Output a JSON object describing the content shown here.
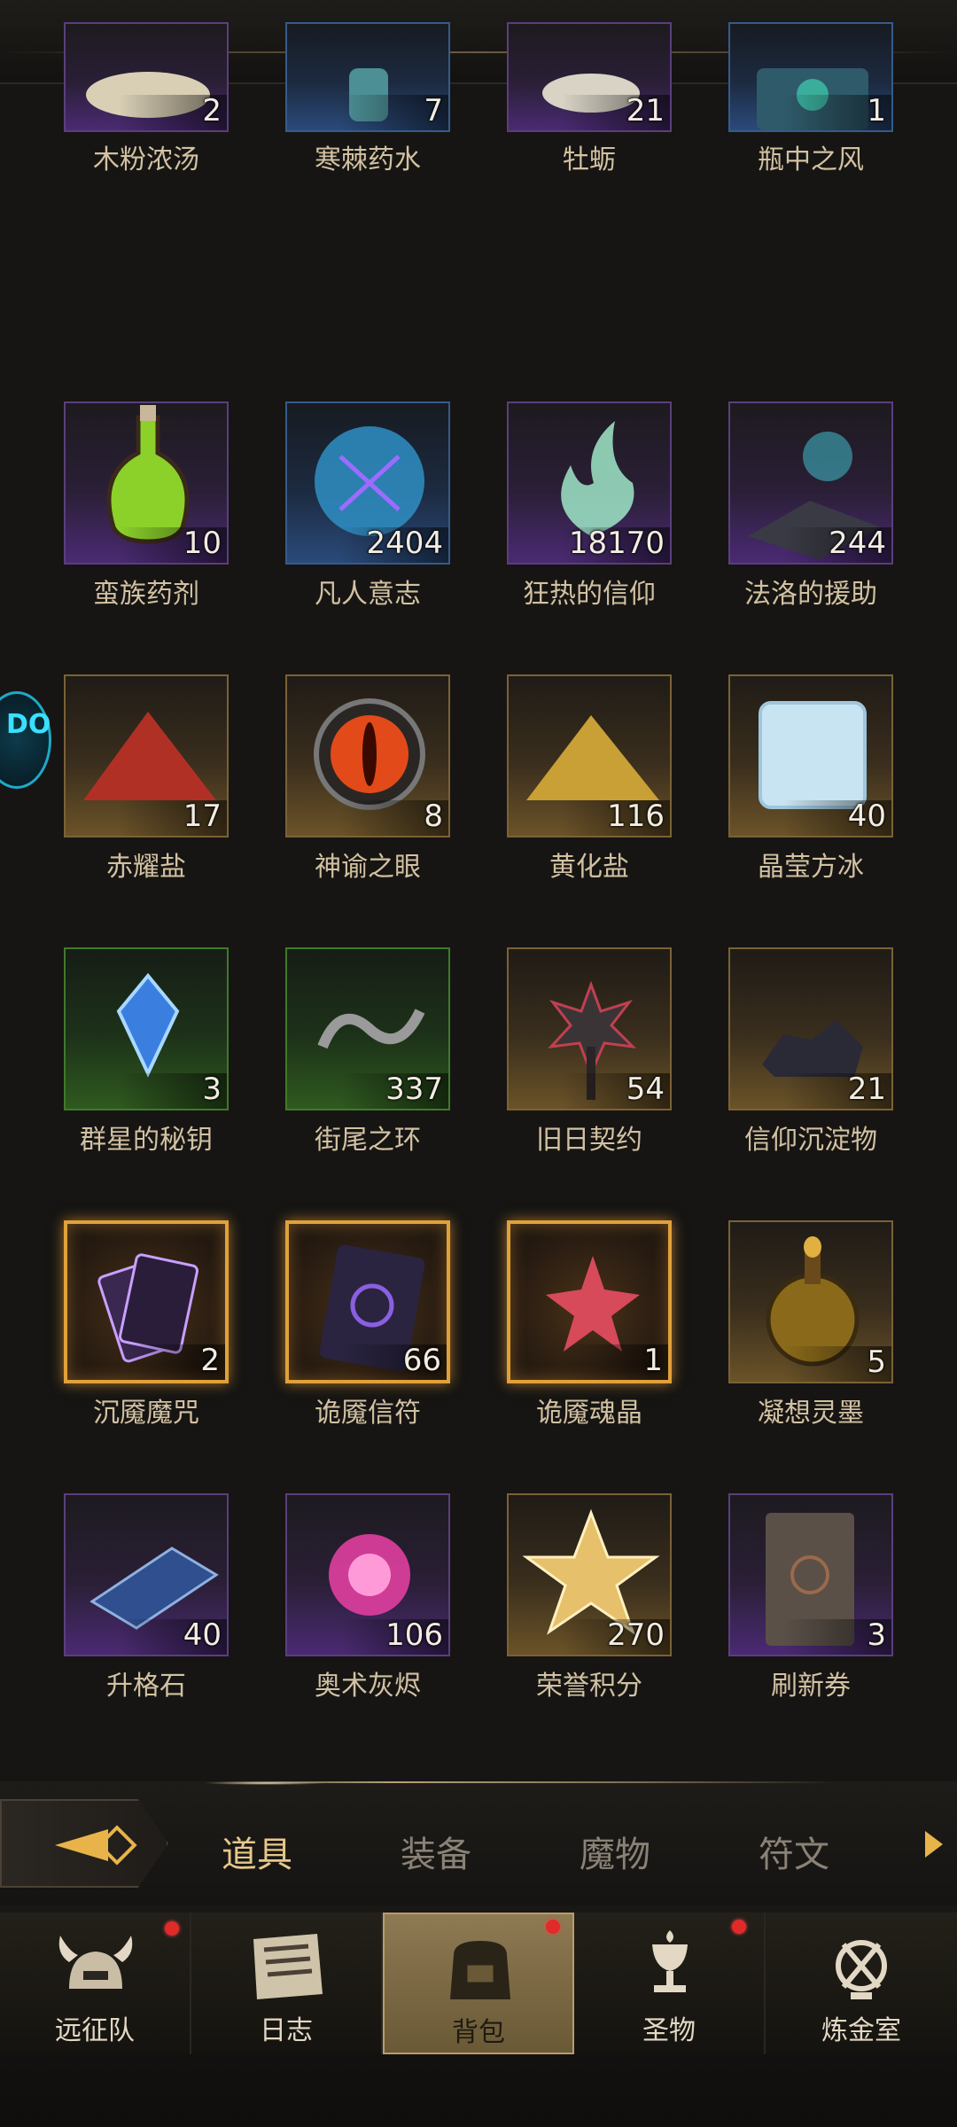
{
  "items": [
    {
      "name": "木粉浓汤",
      "qty": "2",
      "rarity": "purple",
      "icon": "soup-bowl-icon"
    },
    {
      "name": "寒棘药水",
      "qty": "7",
      "rarity": "blue",
      "icon": "potion-vial-icon"
    },
    {
      "name": "牡蛎",
      "qty": "21",
      "rarity": "purple",
      "icon": "oyster-icon"
    },
    {
      "name": "瓶中之风",
      "qty": "1",
      "rarity": "blue",
      "icon": "wind-bottle-icon"
    },
    {
      "name": "蛮族药剂",
      "qty": "10",
      "rarity": "purple",
      "icon": "green-potion-icon"
    },
    {
      "name": "凡人意志",
      "qty": "2404",
      "rarity": "blue",
      "icon": "crystal-orb-icon"
    },
    {
      "name": "狂热的信仰",
      "qty": "18170",
      "rarity": "purple",
      "icon": "spirit-flame-icon"
    },
    {
      "name": "法洛的援助",
      "qty": "244",
      "rarity": "purple",
      "icon": "spell-book-icon"
    },
    {
      "name": "赤耀盐",
      "qty": "17",
      "rarity": "gold",
      "icon": "red-salt-pile-icon"
    },
    {
      "name": "神谕之眼",
      "qty": "8",
      "rarity": "gold",
      "icon": "oracle-eye-icon"
    },
    {
      "name": "黄化盐",
      "qty": "116",
      "rarity": "gold",
      "icon": "yellow-salt-pile-icon"
    },
    {
      "name": "晶莹方冰",
      "qty": "40",
      "rarity": "gold",
      "icon": "ice-cube-icon"
    },
    {
      "name": "群星的秘钥",
      "qty": "3",
      "rarity": "green",
      "icon": "blue-gem-icon"
    },
    {
      "name": "街尾之环",
      "qty": "337",
      "rarity": "green",
      "icon": "infinity-ring-icon"
    },
    {
      "name": "旧日契约",
      "qty": "54",
      "rarity": "gold",
      "icon": "spiked-mace-icon"
    },
    {
      "name": "信仰沉淀物",
      "qty": "21",
      "rarity": "gold",
      "icon": "ore-chunks-icon"
    },
    {
      "name": "沉魇魔咒",
      "qty": "2",
      "rarity": "legend",
      "icon": "cursed-cards-icon"
    },
    {
      "name": "诡魇信符",
      "qty": "66",
      "rarity": "legend",
      "icon": "dark-tablet-icon"
    },
    {
      "name": "诡魇魂晶",
      "qty": "1",
      "rarity": "legend",
      "icon": "star-crystal-icon"
    },
    {
      "name": "凝想灵墨",
      "qty": "5",
      "rarity": "gold",
      "icon": "ink-flask-icon"
    },
    {
      "name": "升格石",
      "qty": "40",
      "rarity": "purple",
      "icon": "blue-ingot-icon"
    },
    {
      "name": "奥术灰烬",
      "qty": "106",
      "rarity": "purple",
      "icon": "arcane-ash-icon"
    },
    {
      "name": "荣誉积分",
      "qty": "270",
      "rarity": "gold",
      "icon": "gold-star-icon"
    },
    {
      "name": "刷新券",
      "qty": "3",
      "rarity": "purple",
      "icon": "scroll-icon"
    }
  ],
  "float_badge": "DO",
  "tabs": [
    {
      "label": "道具",
      "active": true
    },
    {
      "label": "装备",
      "active": false
    },
    {
      "label": "魔物",
      "active": false
    },
    {
      "label": "符文",
      "active": false
    }
  ],
  "nav": [
    {
      "label": "远征队",
      "icon": "viking-helmet-icon",
      "dot": true,
      "active": false
    },
    {
      "label": "日志",
      "icon": "journal-icon",
      "dot": false,
      "active": false
    },
    {
      "label": "背包",
      "icon": "backpack-icon",
      "dot": true,
      "active": true
    },
    {
      "label": "圣物",
      "icon": "relic-chalice-icon",
      "dot": true,
      "active": false
    },
    {
      "label": "炼金室",
      "icon": "alchemy-icon",
      "dot": false,
      "active": false
    }
  ]
}
